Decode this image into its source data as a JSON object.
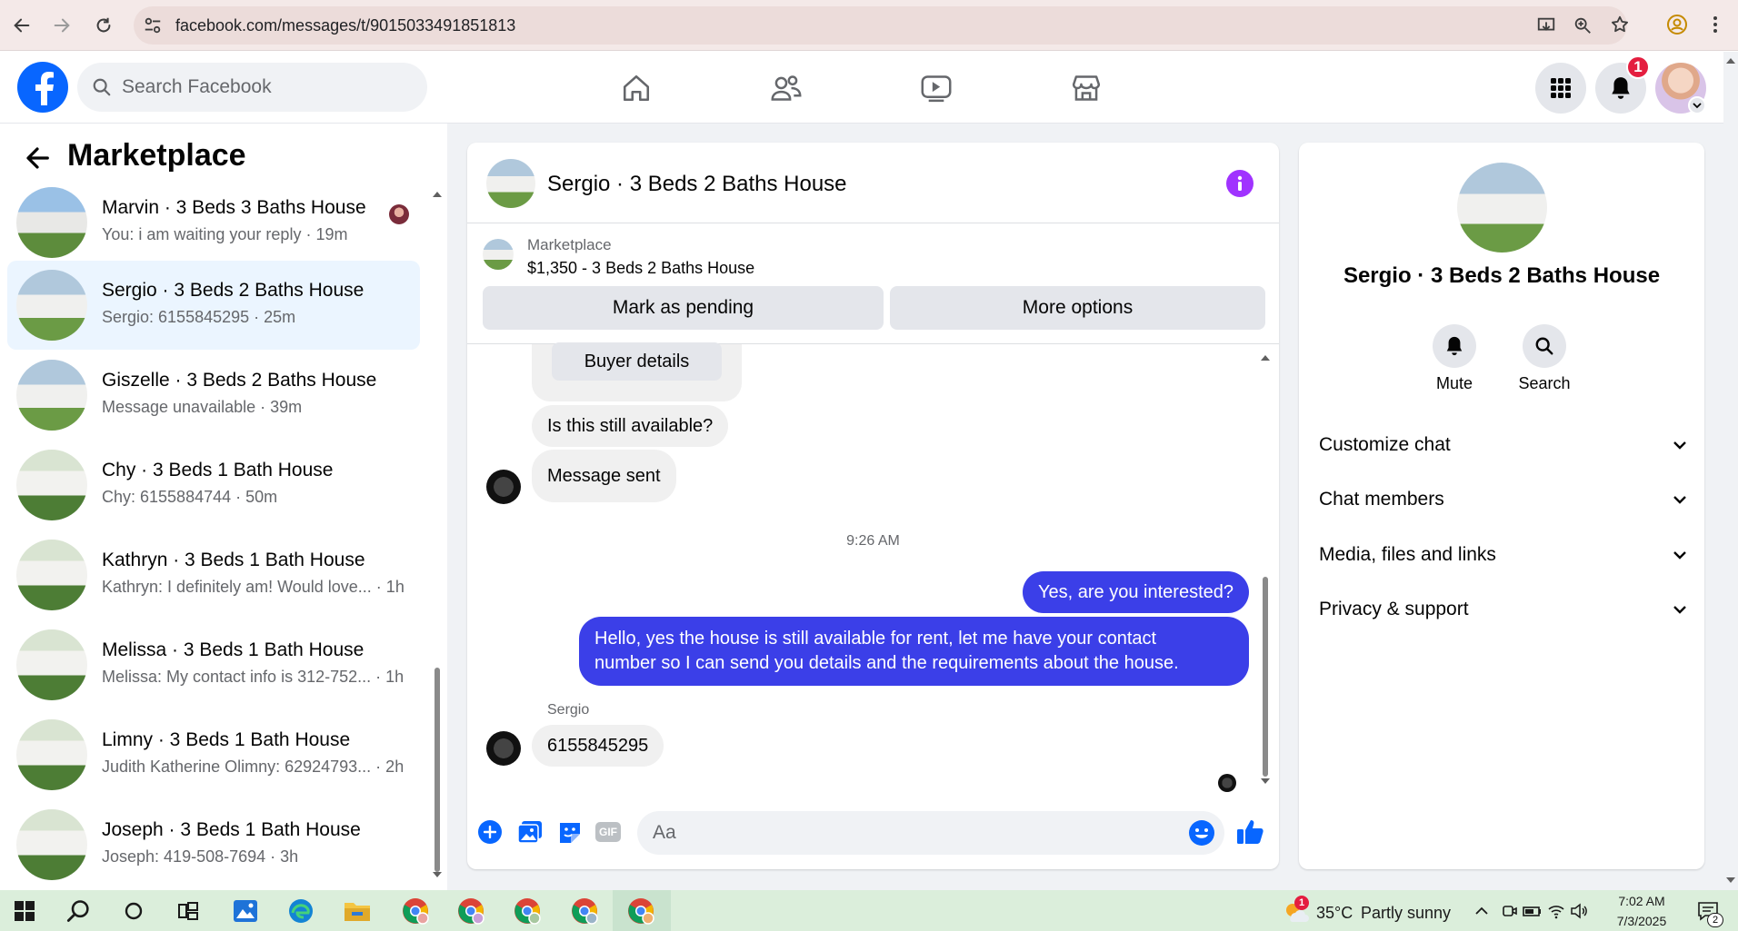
{
  "browser": {
    "url": "facebook.com/messages/t/9015033491851813"
  },
  "header": {
    "search_placeholder": "Search Facebook",
    "notification_count": "1"
  },
  "sidebar": {
    "title": "Marketplace",
    "conversations": [
      {
        "name": "Marvin · 3 Beds 3 Baths House",
        "preview": "You: i am waiting your reply · 19m"
      },
      {
        "name": "Sergio · 3 Beds 2 Baths House",
        "preview": "Sergio: 6155845295 · 25m",
        "active": true
      },
      {
        "name": "Giszelle · 3 Beds 2 Baths House",
        "preview": "Message unavailable · 39m"
      },
      {
        "name": "Chy · 3 Beds 1 Bath House",
        "preview": "Chy: 6155884744 · 50m"
      },
      {
        "name": "Kathryn · 3 Beds 1 Bath House",
        "preview": "Kathryn: I definitely am! Would love... · 1h"
      },
      {
        "name": "Melissa · 3 Beds 1 Bath House",
        "preview": "Melissa: My contact info is 312-752... · 1h"
      },
      {
        "name": "Limny · 3 Beds 1 Bath House",
        "preview": "Judith Katherine Olimny: 62924793... · 2h"
      },
      {
        "name": "Joseph · 3 Beds 1 Bath House",
        "preview": "Joseph: 419-508-7694 · 3h"
      }
    ]
  },
  "chat": {
    "title": "Sergio · 3 Beds 2 Baths House",
    "listing_source": "Marketplace",
    "listing_title": "$1,350 - 3 Beds 2 Baths House",
    "mark_pending_label": "Mark as pending",
    "more_options_label": "More options",
    "buyer_details_label": "Buyer details",
    "msg_available": "Is this still available?",
    "msg_sent": "Message sent",
    "timestamp": "9:26 AM",
    "msg_out_1": "Yes, are you interested?",
    "msg_out_2_line1": "Hello, yes the house is still available for rent, let me have your contact",
    "msg_out_2_line2": "number so I can send you details and the requirements about the house.",
    "sender_name": "Sergio",
    "msg_phone": "6155845295",
    "composer_placeholder": "Aa"
  },
  "details": {
    "title": "Sergio · 3 Beds 2 Baths House",
    "mute_label": "Mute",
    "search_label": "Search",
    "sections": [
      "Customize chat",
      "Chat members",
      "Media, files and links",
      "Privacy & support"
    ]
  },
  "taskbar": {
    "weather_badge": "1",
    "temperature": "35°C",
    "weather": "Partly sunny",
    "time": "7:02 AM",
    "date": "7/3/2025",
    "notif_count": "2"
  },
  "colors": {
    "fb_blue": "#0866ff",
    "messenger_blue": "#3b3fe8",
    "info_purple": "#a033ff",
    "active_row": "#ebf5ff"
  }
}
